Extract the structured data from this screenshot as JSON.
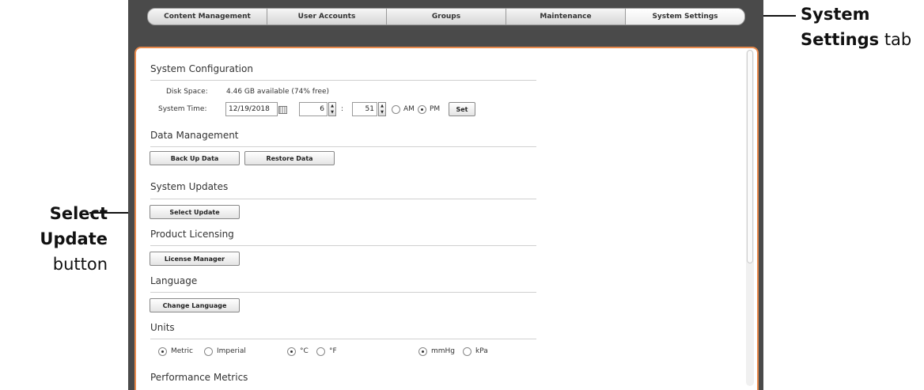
{
  "callouts": {
    "tab_bold": "System Settings",
    "tab_suffix": "tab",
    "button_bold": "Select Update",
    "button_suffix": "button"
  },
  "tabs": [
    {
      "label": "Content Management",
      "active": false
    },
    {
      "label": "User Accounts",
      "active": false
    },
    {
      "label": "Groups",
      "active": false
    },
    {
      "label": "Maintenance",
      "active": false
    },
    {
      "label": "System Settings",
      "active": true
    }
  ],
  "system_configuration": {
    "title": "System Configuration",
    "disk_space_label": "Disk Space:",
    "disk_space_value": "4.46 GB available (74% free)",
    "system_time_label": "System Time:",
    "date_value": "12/19/2018",
    "hour_value": "6",
    "time_separator": ":",
    "minute_value": "51",
    "am_label": "AM",
    "pm_label": "PM",
    "meridiem_selected": "PM",
    "set_button": "Set"
  },
  "data_management": {
    "title": "Data Management",
    "backup_button": "Back Up Data",
    "restore_button": "Restore Data"
  },
  "system_updates": {
    "title": "System Updates",
    "select_update_button": "Select Update"
  },
  "product_licensing": {
    "title": "Product Licensing",
    "license_manager_button": "License Manager"
  },
  "language": {
    "title": "Language",
    "change_language_button": "Change Language"
  },
  "units": {
    "title": "Units",
    "metric_label": "Metric",
    "imperial_label": "Imperial",
    "celsius_label": "°C",
    "fahrenheit_label": "°F",
    "mmhg_label": "mmHg",
    "kpa_label": "kPa",
    "system_selected": "Metric",
    "temperature_selected": "°C",
    "pressure_selected": "mmHg"
  },
  "performance_metrics": {
    "title": "Performance Metrics"
  },
  "colors": {
    "panel_border": "#e98a4c",
    "frame_background": "#4a4a4a"
  }
}
